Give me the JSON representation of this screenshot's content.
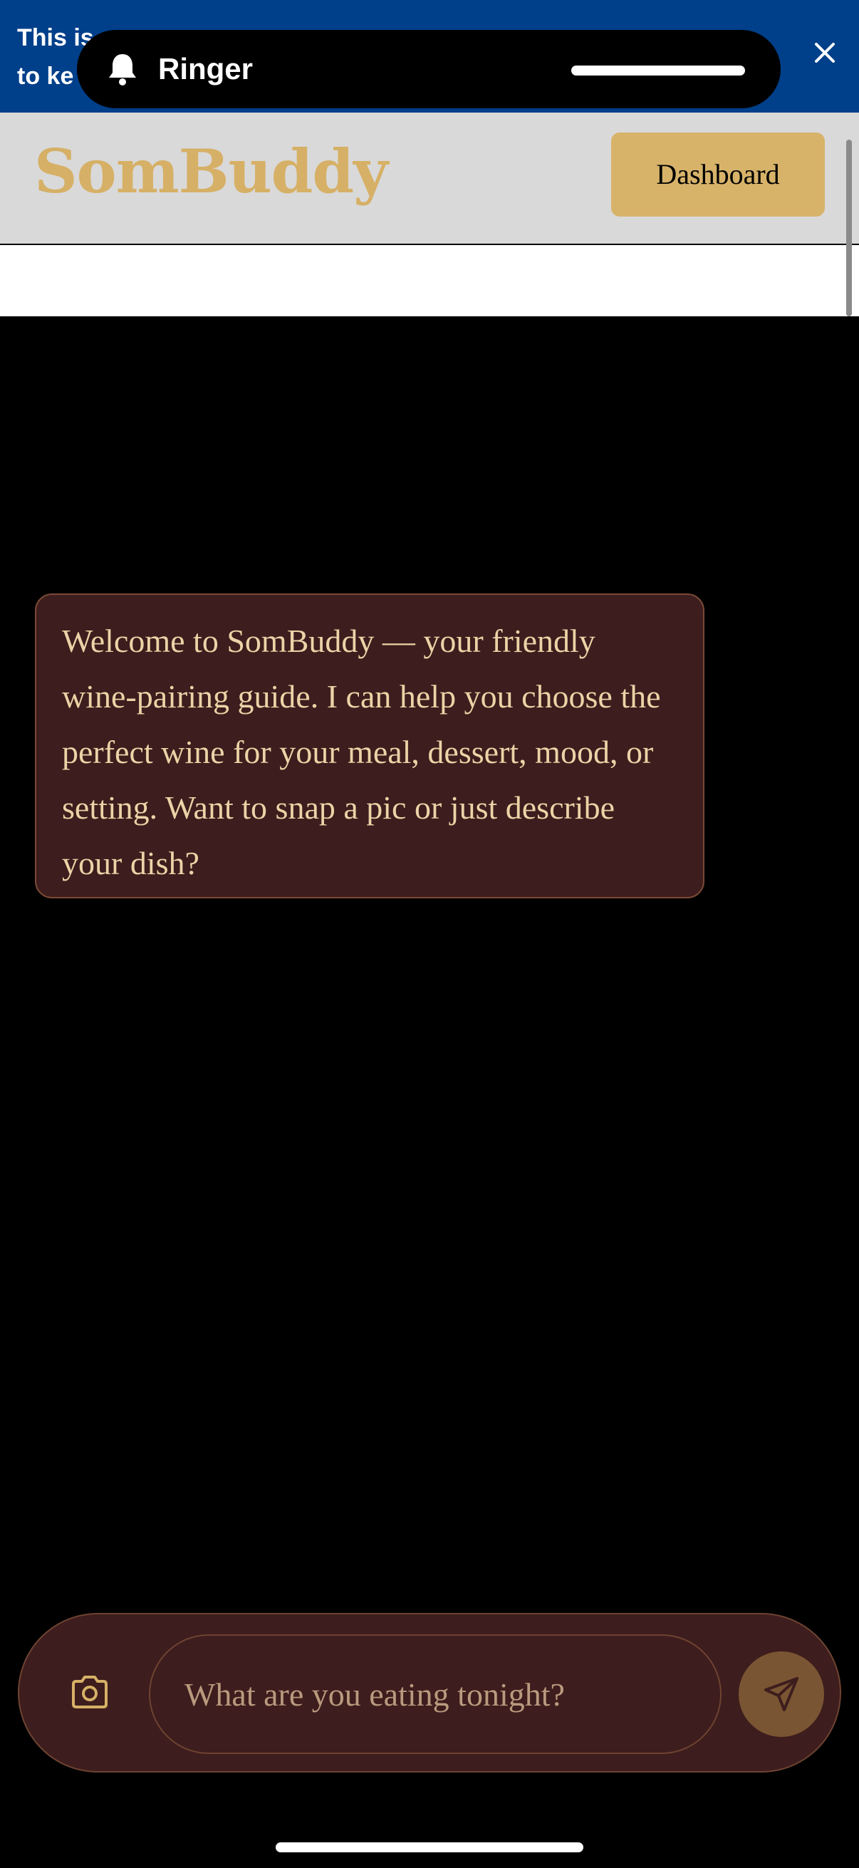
{
  "banner": {
    "text": "This is a temporary preview. Deploy your web app before sharing to keep it running.",
    "visible_start": "This is",
    "visible_line2": "to ke"
  },
  "ringer": {
    "label": "Ringer",
    "icon": "bell-icon"
  },
  "header": {
    "logo": "SomBuddy",
    "dashboard_label": "Dashboard"
  },
  "chat": {
    "messages": [
      {
        "role": "assistant",
        "text": "Welcome to SomBuddy — your friendly wine-pairing guide. I can help you choose the perfect wine for your meal, dessert, mood, or setting. Want to snap a pic or just describe your dish?"
      }
    ]
  },
  "composer": {
    "placeholder": "What are you eating tonight?",
    "value": "",
    "camera_icon": "camera-icon",
    "send_icon": "send-icon"
  },
  "colors": {
    "banner": "#003f8a",
    "accent_gold": "#d6b066",
    "bubble_bg": "#3d1d1d",
    "bubble_text": "#ecd3a7",
    "send_button": "#7a5533"
  }
}
